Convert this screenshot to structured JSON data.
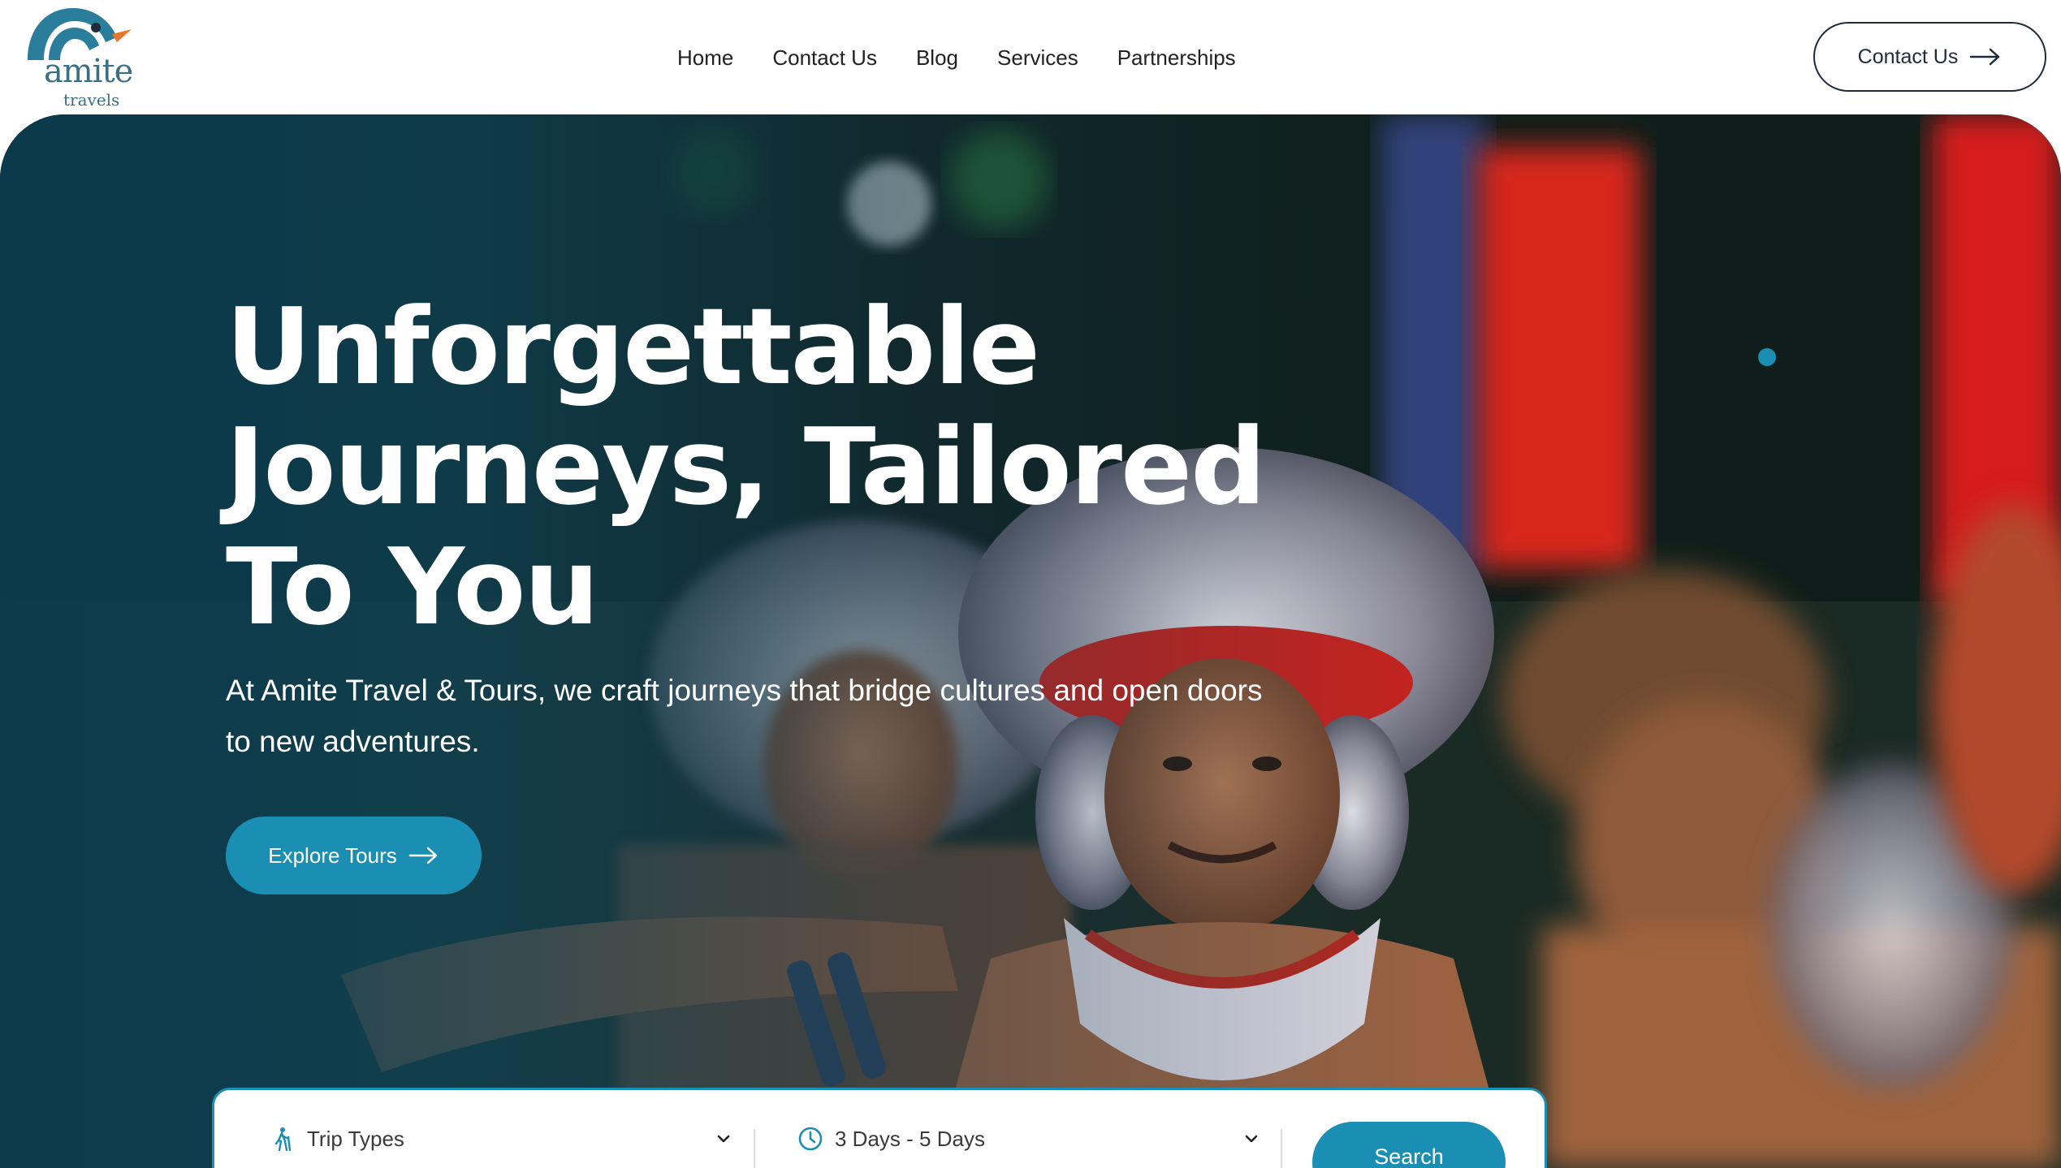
{
  "brand": {
    "name": "amite",
    "sub": "travels",
    "accent_color": "#1b8fb3",
    "logo_blue": "#2a7d9b",
    "logo_orange": "#e8762c"
  },
  "nav": {
    "items": [
      {
        "label": "Home"
      },
      {
        "label": "Contact Us"
      },
      {
        "label": "Blog"
      },
      {
        "label": "Services"
      },
      {
        "label": "Partnerships"
      }
    ],
    "cta_label": "Contact Us",
    "cta_icon": "arrow-right-icon"
  },
  "hero": {
    "headline": "Unforgettable Journeys, Tailored To You",
    "subtext": "At Amite Travel & Tours, we craft journeys that bridge cultures and open doors to new adventures.",
    "button_label": "Explore Tours",
    "button_icon": "arrow-right-icon",
    "background": "Sri Lankan kandyan dancers in ornate silver headdresses at night"
  },
  "search": {
    "trip_type": {
      "value": "Trip Types",
      "icon": "hiker-icon"
    },
    "duration": {
      "value": "3 Days - 5 Days",
      "icon": "clock-icon"
    },
    "button_label": "Search"
  }
}
